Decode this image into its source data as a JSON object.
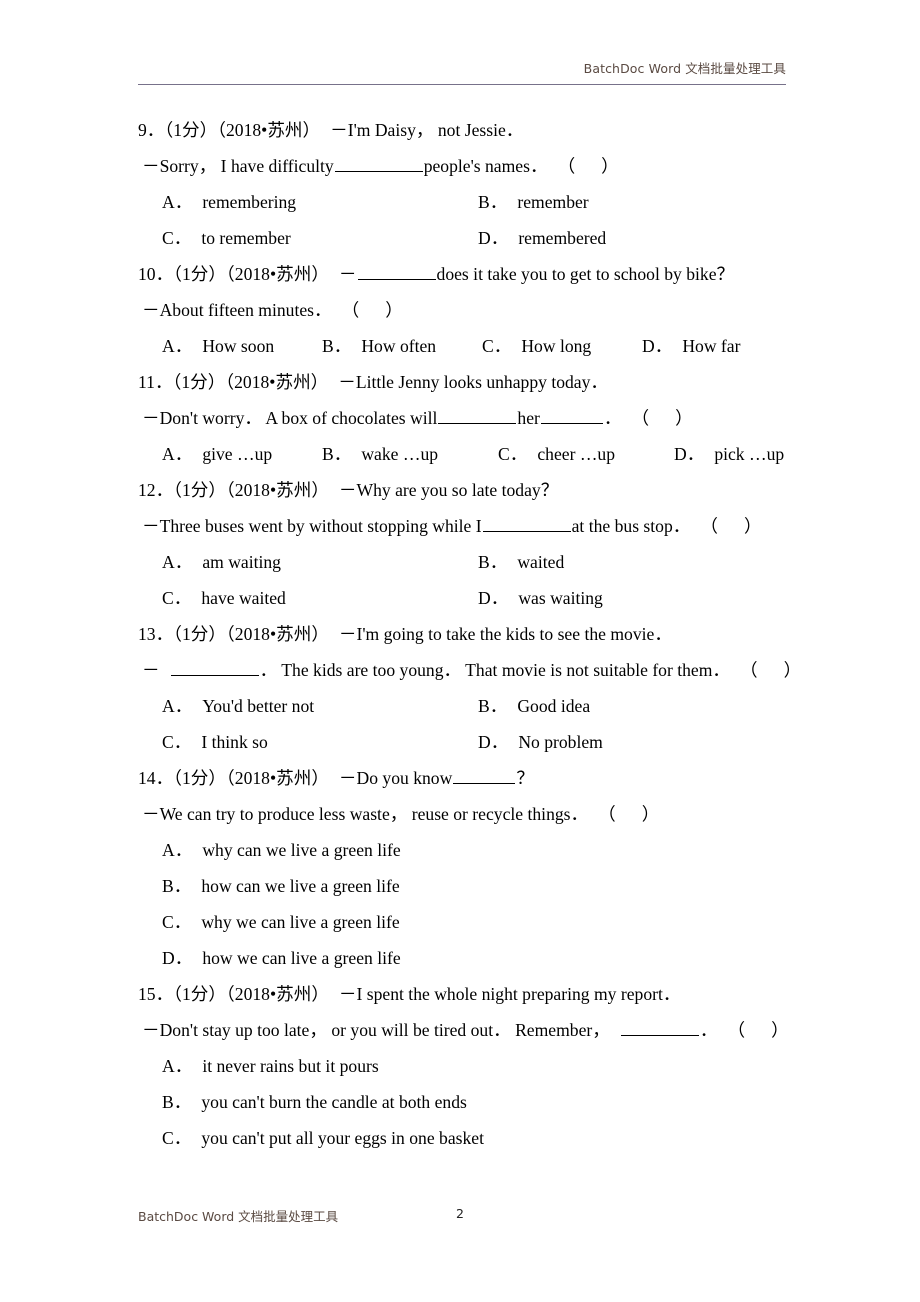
{
  "header": {
    "text": "BatchDoc Word 文档批量处理工具"
  },
  "footer": {
    "text": "BatchDoc Word 文档批量处理工具",
    "page_number": "2"
  },
  "questions": [
    {
      "number": "9．",
      "score": "（1分）",
      "source": "（2018•苏州）",
      "stem": "－I'm Daisy，  not Jessie．",
      "reply_before": "－Sorry，  I have difficulty",
      "reply_after": "people's names．",
      "paren_open": "（",
      "paren_close": "）",
      "layout": "two-column",
      "options": [
        {
          "letter": "A．",
          "text": "remembering"
        },
        {
          "letter": "B．",
          "text": "remember"
        },
        {
          "letter": "C．",
          "text": "to remember"
        },
        {
          "letter": "D．",
          "text": "remembered"
        }
      ]
    },
    {
      "number": "10．",
      "score": "（1分）",
      "source": "（2018•苏州）",
      "stem_before": "－",
      "stem_after": "does it take you to get to school by bike？",
      "reply": "－About fifteen minutes．",
      "paren_open": "（",
      "paren_close": "）",
      "layout": "four-column",
      "options": [
        {
          "letter": "A．",
          "text": "How soon"
        },
        {
          "letter": "B．",
          "text": "How often"
        },
        {
          "letter": "C．",
          "text": "How long"
        },
        {
          "letter": "D．",
          "text": "How far"
        }
      ]
    },
    {
      "number": "11．",
      "score": "（1分）",
      "source": "（2018•苏州）",
      "stem": "－Little Jenny looks unhappy today．",
      "reply_before": "－Don't worry．  A box of chocolates will",
      "reply_mid": "her",
      "reply_after": "．",
      "paren_open": "（",
      "paren_close": "）",
      "layout": "four-column",
      "options": [
        {
          "letter": "A．",
          "text": "give …up"
        },
        {
          "letter": "B．",
          "text": "wake …up"
        },
        {
          "letter": "C．",
          "text": "cheer …up"
        },
        {
          "letter": "D．",
          "text": "pick …up"
        }
      ]
    },
    {
      "number": "12．",
      "score": "（1分）",
      "source": "（2018•苏州）",
      "stem": "－Why are you so late today？",
      "reply_before": "－Three buses went by without stopping while I",
      "reply_after": "at the bus stop．",
      "paren_open": "（",
      "paren_close": "）",
      "layout": "two-column",
      "options": [
        {
          "letter": "A．",
          "text": "am waiting"
        },
        {
          "letter": "B．",
          "text": "waited"
        },
        {
          "letter": "C．",
          "text": "have waited"
        },
        {
          "letter": "D．",
          "text": "was waiting"
        }
      ]
    },
    {
      "number": "13．",
      "score": "（1分）",
      "source": "（2018•苏州）",
      "stem": "－I'm going to take the kids to see the movie．",
      "reply_before": "－",
      "reply_after": "．  The kids are too young．  That movie is not suitable for them．",
      "paren_open": "（",
      "paren_close": "）",
      "layout": "two-column",
      "options": [
        {
          "letter": "A．",
          "text": "You'd better not"
        },
        {
          "letter": "B．",
          "text": "Good idea"
        },
        {
          "letter": "C．",
          "text": "I think so"
        },
        {
          "letter": "D．",
          "text": "No problem"
        }
      ]
    },
    {
      "number": "14．",
      "score": "（1分）",
      "source": "（2018•苏州）",
      "stem_before": "－Do you know",
      "stem_after": "？",
      "reply": "－We can try to produce less waste，  reuse or recycle things．",
      "paren_open": "（",
      "paren_close": "）",
      "layout": "stacked",
      "options": [
        {
          "letter": "A．",
          "text": "why can we live a green life"
        },
        {
          "letter": "B．",
          "text": "how can we live a green life"
        },
        {
          "letter": "C．",
          "text": "why we can live a green life"
        },
        {
          "letter": "D．",
          "text": "how we can live a green life"
        }
      ]
    },
    {
      "number": "15．",
      "score": "（1分）",
      "source": "（2018•苏州）",
      "stem": "－I spent the whole night preparing my report．",
      "reply_before": "－Don't stay up too late，  or you will be tired out．  Remember，",
      "reply_after": "．",
      "paren_open": "（",
      "paren_close": "）",
      "layout": "stacked",
      "options": [
        {
          "letter": "A．",
          "text": "it never rains but it pours"
        },
        {
          "letter": "B．",
          "text": "you can't burn the candle at both ends"
        },
        {
          "letter": "C．",
          "text": "you can't put all your eggs in one basket"
        }
      ]
    }
  ]
}
